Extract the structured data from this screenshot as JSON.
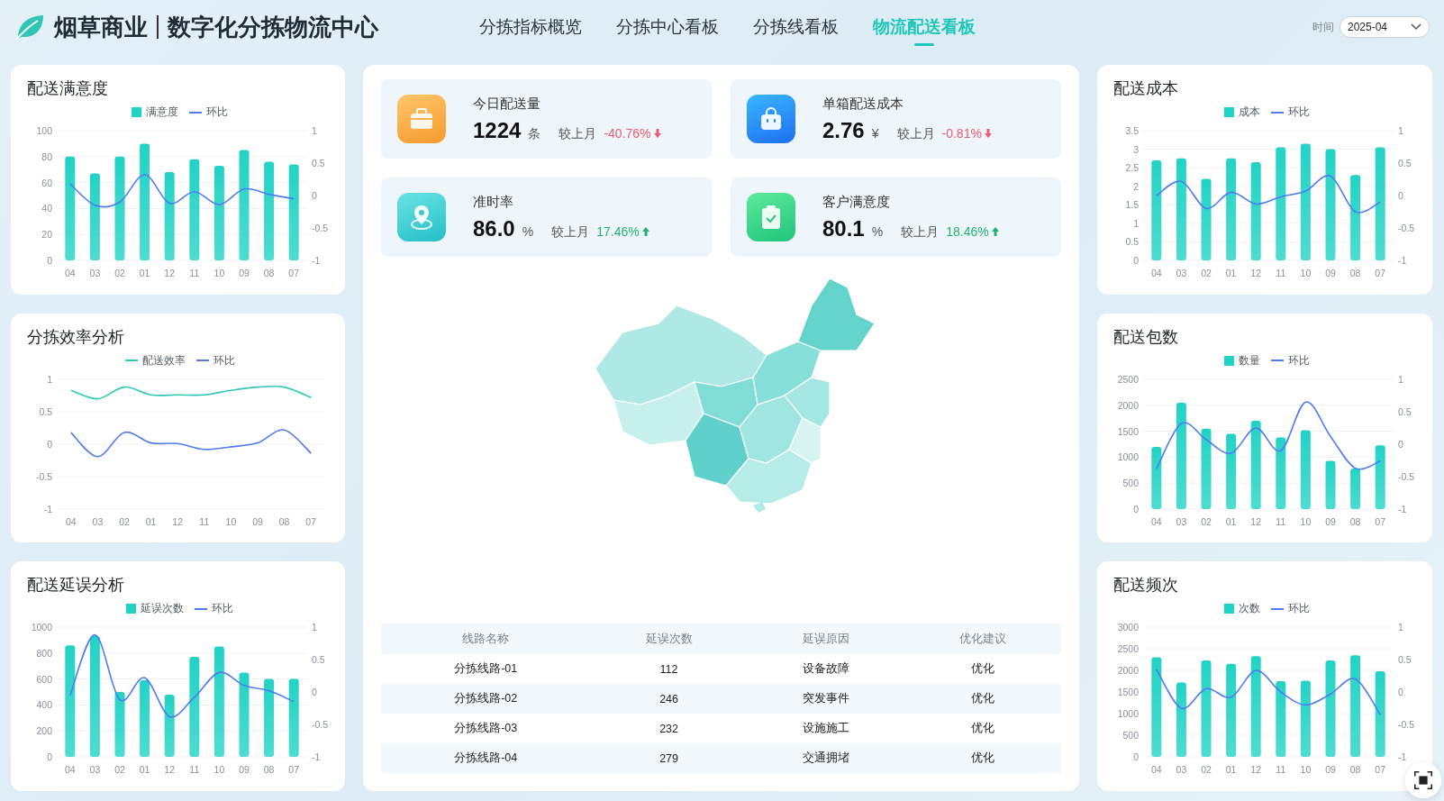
{
  "header": {
    "brand": "烟草商业",
    "title": "数字化分拣物流中心",
    "nav": [
      {
        "label": "分拣指标概览",
        "selected": false
      },
      {
        "label": "分拣中心看板",
        "selected": false
      },
      {
        "label": "分拣线看板",
        "selected": false
      },
      {
        "label": "物流配送看板",
        "selected": true
      }
    ],
    "time_label": "时间",
    "time_value": "2025-04"
  },
  "left_panels": [
    {
      "title": "配送满意度",
      "chart_data": {
        "type": "bar",
        "grid": true,
        "categories": [
          "04",
          "03",
          "02",
          "01",
          "12",
          "11",
          "10",
          "09",
          "08",
          "07"
        ],
        "ylim": [
          0,
          100
        ],
        "yticks": [
          0,
          20,
          40,
          60,
          80,
          100
        ],
        "y2lim": [
          -1,
          1
        ],
        "y2ticks": [
          -1,
          -0.5,
          0,
          0.5,
          1
        ],
        "series": [
          {
            "name": "满意度",
            "color": "#22d3c5",
            "values": [
              80,
              67,
              80,
              90,
              68,
              78,
              73,
              85,
              76,
              74
            ]
          },
          {
            "name": "环比",
            "type": "line",
            "axis": "y2",
            "color": "#4f7cf0",
            "values": [
              0.18,
              -0.15,
              -0.1,
              0.32,
              -0.12,
              0.06,
              -0.14,
              0.1,
              0.02,
              -0.05
            ]
          }
        ]
      }
    },
    {
      "title": "分拣效率分析",
      "chart_data": {
        "type": "line",
        "grid": true,
        "categories": [
          "04",
          "03",
          "02",
          "01",
          "12",
          "11",
          "10",
          "09",
          "08",
          "07"
        ],
        "ylim": [
          -1,
          1
        ],
        "yticks": [
          -1,
          -0.5,
          0,
          0.5,
          1
        ],
        "series": [
          {
            "name": "配送效率",
            "color": "#2ec9b8",
            "values": [
              0.83,
              0.7,
              0.88,
              0.76,
              0.76,
              0.76,
              0.83,
              0.88,
              0.88,
              0.72
            ]
          },
          {
            "name": "环比",
            "color": "#4f7cf0",
            "values": [
              0.18,
              -0.19,
              0.18,
              0.02,
              0.01,
              -0.08,
              -0.04,
              0.02,
              0.22,
              -0.14
            ]
          }
        ]
      }
    },
    {
      "title": "配送延误分析",
      "chart_data": {
        "type": "bar",
        "grid": true,
        "categories": [
          "04",
          "03",
          "02",
          "01",
          "12",
          "11",
          "10",
          "09",
          "08",
          "07"
        ],
        "ylim": [
          0,
          1000
        ],
        "yticks": [
          0,
          200,
          400,
          600,
          800,
          1000
        ],
        "y2lim": [
          -1,
          1
        ],
        "y2ticks": [
          -1,
          -0.5,
          0,
          0.5,
          1
        ],
        "series": [
          {
            "name": "延误次数",
            "color": "#22d3c5",
            "values": [
              860,
              930,
              500,
              590,
              480,
              770,
              850,
              650,
              600,
              600
            ]
          },
          {
            "name": "环比",
            "type": "line",
            "axis": "y2",
            "color": "#4f7cf0",
            "values": [
              -0.05,
              0.88,
              -0.12,
              0.22,
              -0.38,
              -0.08,
              0.3,
              0.1,
              0.02,
              -0.15
            ]
          }
        ]
      }
    }
  ],
  "kpis": [
    {
      "label": "今日配送量",
      "value": "1224",
      "unit": "条",
      "compare_label": "较上月",
      "change": "-40.76%",
      "rising": false
    },
    {
      "label": "单箱配送成本",
      "value": "2.76",
      "unit": "¥",
      "compare_label": "较上月",
      "change": "-0.81%",
      "rising": false
    },
    {
      "label": "准时率",
      "value": "86.0",
      "unit": "%",
      "compare_label": "较上月",
      "change": "17.46%",
      "rising": true
    },
    {
      "label": "客户满意度",
      "value": "80.1",
      "unit": "%",
      "compare_label": "较上月",
      "change": "18.46%",
      "rising": true
    }
  ],
  "table": {
    "columns": [
      "线路名称",
      "延误次数",
      "延误原因",
      "优化建议"
    ],
    "rows": [
      [
        "分拣线路-01",
        "112",
        "设备故障",
        "优化"
      ],
      [
        "分拣线路-02",
        "246",
        "突发事件",
        "优化"
      ],
      [
        "分拣线路-03",
        "232",
        "设施施工",
        "优化"
      ],
      [
        "分拣线路-04",
        "279",
        "交通拥堵",
        "优化"
      ]
    ]
  },
  "right_panels": [
    {
      "title": "配送成本",
      "chart_data": {
        "type": "bar",
        "grid": true,
        "categories": [
          "04",
          "03",
          "02",
          "01",
          "12",
          "11",
          "10",
          "09",
          "08",
          "07"
        ],
        "ylim": [
          0,
          3.5
        ],
        "yticks": [
          0,
          0.5,
          1,
          1.5,
          2,
          2.5,
          3,
          3.5
        ],
        "y2lim": [
          -1,
          1
        ],
        "y2ticks": [
          -1,
          -0.5,
          0,
          0.5,
          1
        ],
        "series": [
          {
            "name": "成本",
            "color": "#22d3c5",
            "values": [
              2.7,
              2.75,
              2.2,
              2.75,
              2.65,
              3.05,
              3.15,
              3.0,
              2.3,
              3.05
            ]
          },
          {
            "name": "环比",
            "type": "line",
            "axis": "y2",
            "color": "#4f7cf0",
            "values": [
              0,
              0.22,
              -0.2,
              0.05,
              -0.13,
              -0.02,
              0.07,
              0.3,
              -0.25,
              -0.1
            ]
          }
        ]
      }
    },
    {
      "title": "配送包数",
      "chart_data": {
        "type": "bar",
        "grid": true,
        "categories": [
          "04",
          "03",
          "02",
          "01",
          "12",
          "11",
          "10",
          "09",
          "08",
          "07"
        ],
        "ylim": [
          0,
          2500
        ],
        "yticks": [
          0,
          500,
          1000,
          1500,
          2000,
          2500
        ],
        "y2lim": [
          -1,
          1
        ],
        "y2ticks": [
          -1,
          -0.5,
          0,
          0.5,
          1
        ],
        "series": [
          {
            "name": "数量",
            "color": "#22d3c5",
            "values": [
              1200,
              2050,
              1550,
              1450,
              1700,
              1380,
              1520,
              930,
              780,
              1230
            ]
          },
          {
            "name": "环比",
            "type": "line",
            "axis": "y2",
            "color": "#4f7cf0",
            "values": [
              -0.38,
              0.32,
              0.07,
              -0.14,
              0.25,
              -0.1,
              0.65,
              0.12,
              -0.37,
              -0.26
            ]
          }
        ]
      }
    },
    {
      "title": "配送频次",
      "chart_data": {
        "type": "bar",
        "grid": true,
        "categories": [
          "04",
          "03",
          "02",
          "01",
          "12",
          "11",
          "10",
          "09",
          "08",
          "07"
        ],
        "ylim": [
          0,
          3000
        ],
        "yticks": [
          0,
          500,
          1000,
          1500,
          2000,
          2500,
          3000
        ],
        "y2lim": [
          -1,
          1
        ],
        "y2ticks": [
          -1,
          -0.5,
          0,
          0.5,
          1
        ],
        "series": [
          {
            "name": "次数",
            "color": "#22d3c5",
            "values": [
              2300,
              1720,
              2230,
              2150,
              2330,
              1750,
              1760,
              2230,
              2350,
              1980
            ]
          },
          {
            "name": "环比",
            "type": "line",
            "axis": "y2",
            "color": "#4f7cf0",
            "values": [
              0.35,
              -0.25,
              0.05,
              -0.08,
              0.33,
              0.0,
              -0.2,
              -0.03,
              0.2,
              -0.35
            ]
          }
        ]
      }
    }
  ]
}
